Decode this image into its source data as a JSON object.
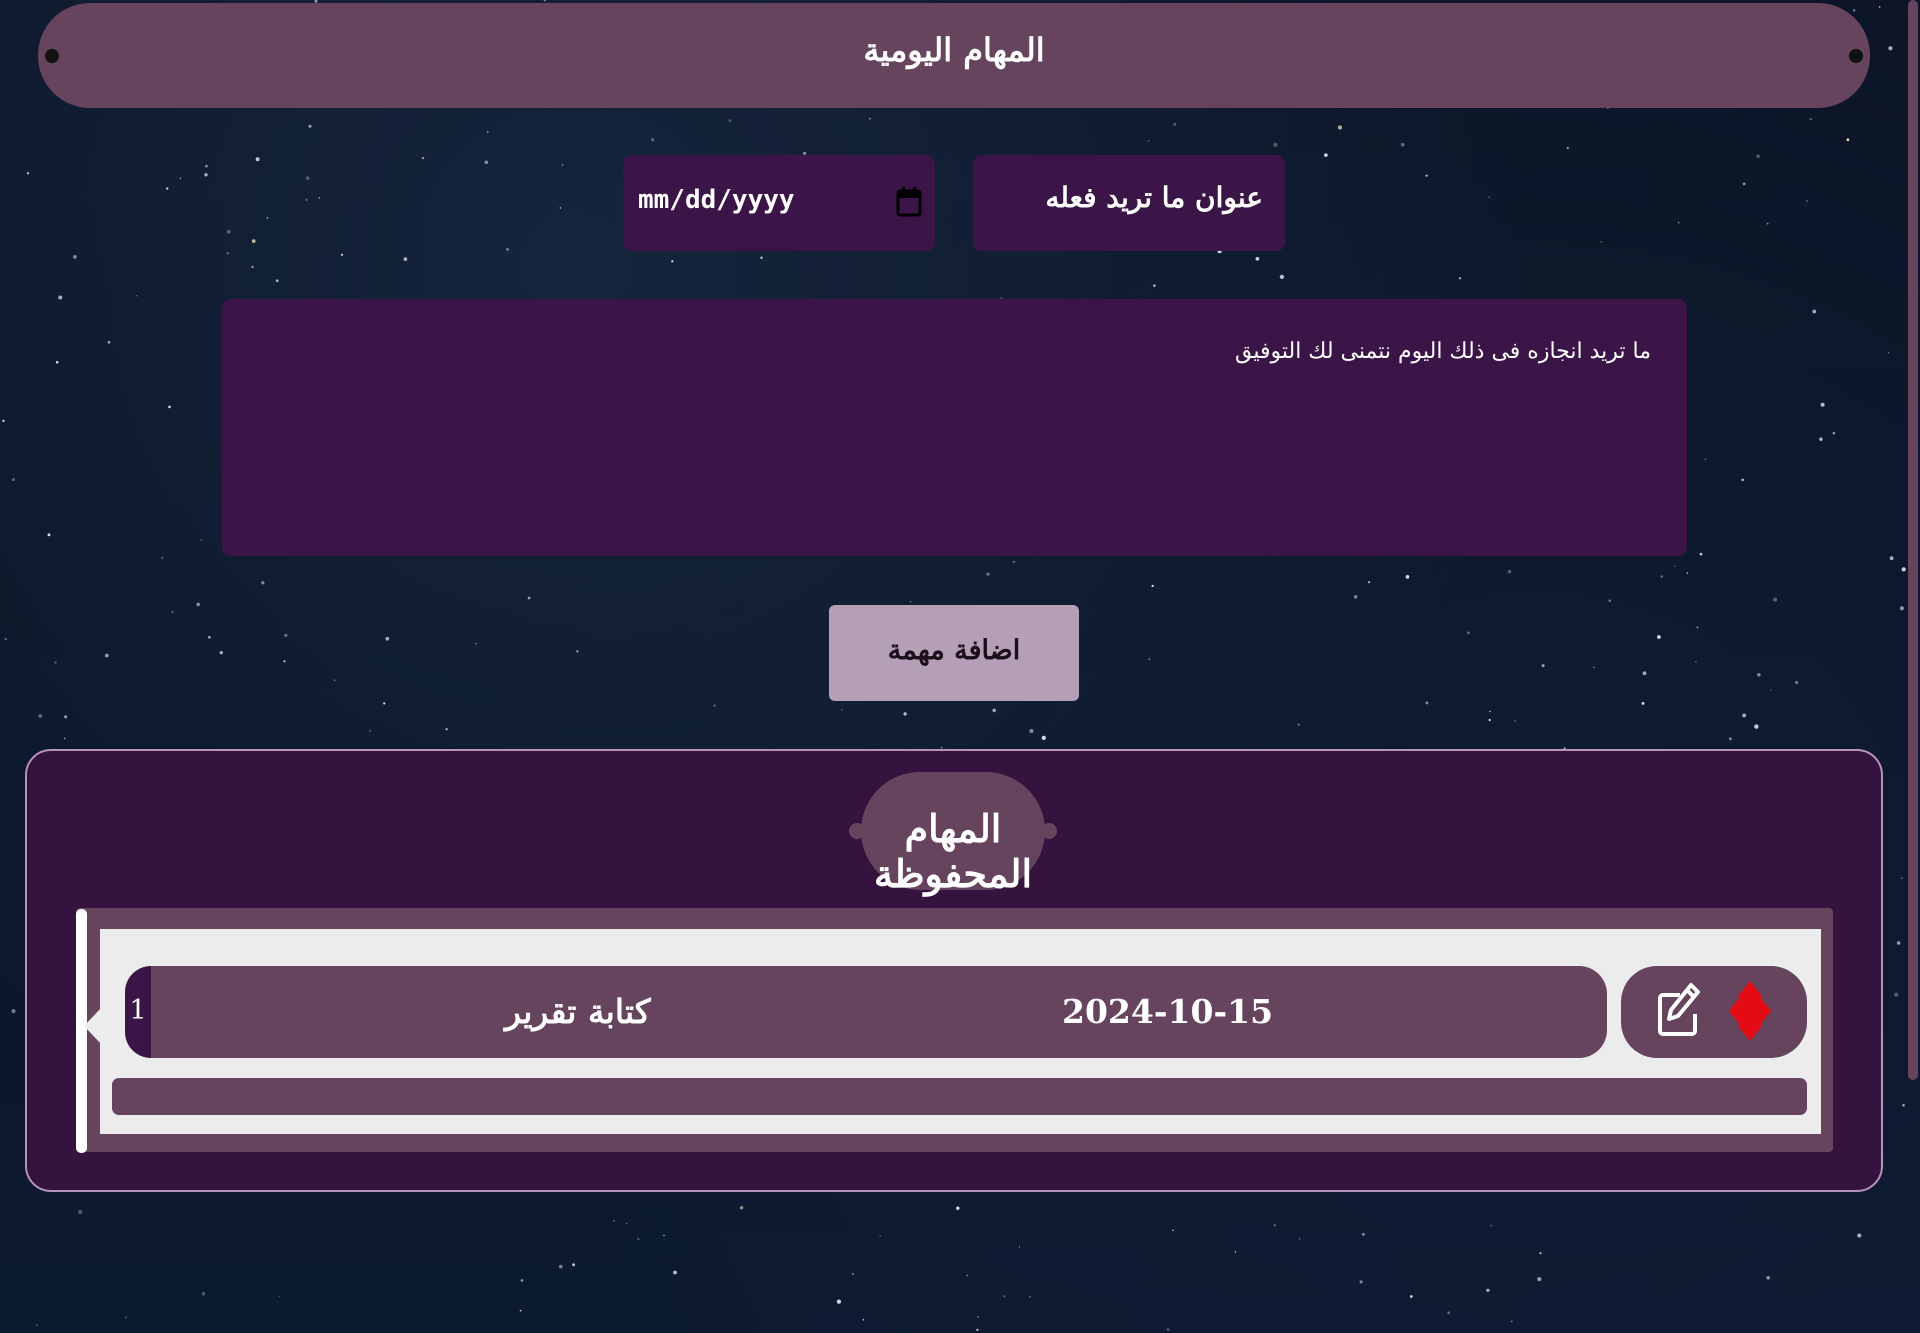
{
  "header": {
    "title": "المهام اليومية"
  },
  "form": {
    "title_placeholder": "عنوان ما تريد فعله",
    "date_placeholder": "mm/dd/yyyy",
    "description_placeholder": "ما تريد انجازه فى ذلك اليوم نتمنى لك التوفيق",
    "add_button_label": "اضافة مهمة"
  },
  "saved": {
    "section_title": "المهام المحفوظة",
    "tasks": [
      {
        "index": "1",
        "title": "كتابة تقرير",
        "date": "2024-10-15"
      }
    ]
  },
  "icons": {
    "calendar": "calendar-icon",
    "edit": "edit-icon",
    "delete": "delete-icon"
  },
  "colors": {
    "background": "#0b1628",
    "header": "#66445e",
    "field": "#3c1548",
    "button": "#b59fb6",
    "panel": "#34143f",
    "delete_icon": "#e30b14"
  }
}
